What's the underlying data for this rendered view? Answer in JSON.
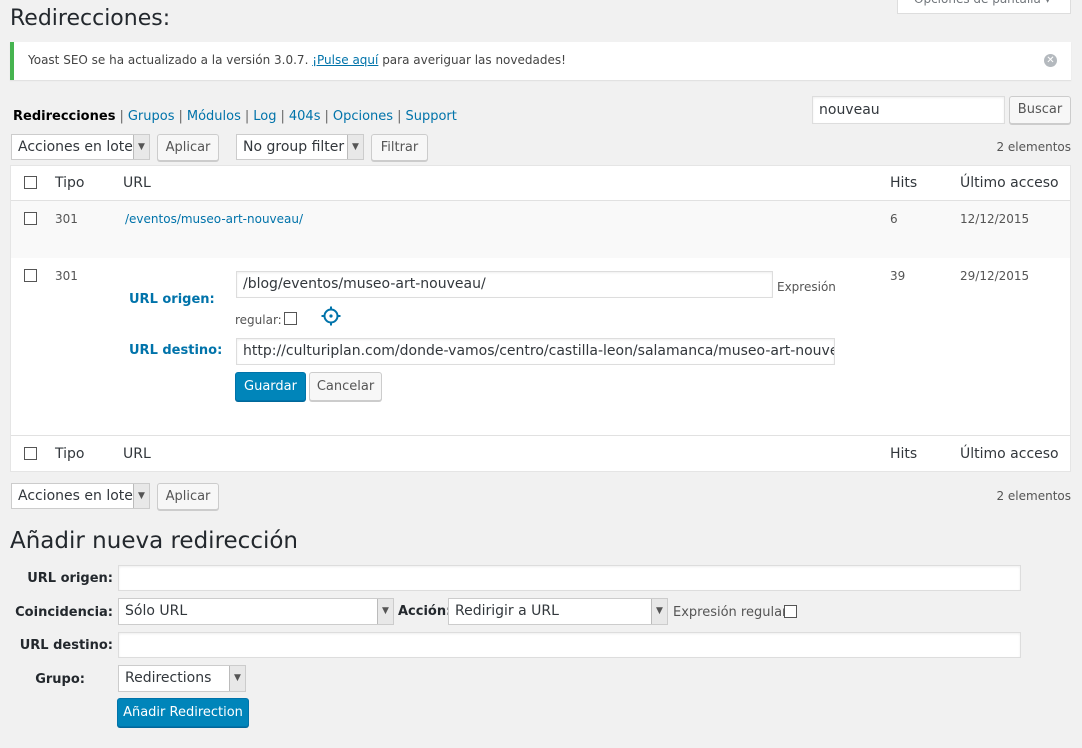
{
  "page": {
    "title": "Redirecciones:",
    "screen_options": "Opciones de pantalla ▾"
  },
  "notice": {
    "text_before": "Yoast SEO se ha actualizado a la versión 3.0.7.",
    "link": "¡Pulse aquí",
    "text_after": "para averiguar las novedades!"
  },
  "nav": {
    "items": [
      "Redirecciones",
      "Grupos",
      "Módulos",
      "Log",
      "404s",
      "Opciones",
      "Support"
    ],
    "separator": "|"
  },
  "search": {
    "value": "nouveau",
    "button": "Buscar"
  },
  "toolbar_top": {
    "bulk_actions": "Acciones en lote",
    "apply": "Aplicar",
    "group_filter": "No group filter",
    "filter": "Filtrar",
    "count": "2 elementos"
  },
  "table": {
    "columns": {
      "type": "Tipo",
      "url": "URL",
      "hits": "Hits",
      "last_access": "Último acceso"
    },
    "rows": [
      {
        "type": "301",
        "url": "/eventos/museo-art-nouveau/",
        "hits": "6",
        "last_access": "12/12/2015"
      },
      {
        "type": "301",
        "hits": "39",
        "last_access": "29/12/2015"
      }
    ],
    "edit": {
      "source_label": "URL origen:",
      "source_value": "/blog/eventos/museo-art-nouveau/",
      "regex_label_1": "Expresión",
      "regex_label_2": "regular:",
      "target_label": "URL destino:",
      "target_value": "http://culturiplan.com/donde-vamos/centro/castilla-leon/salamanca/museo-art-nouveau",
      "save": "Guardar",
      "cancel": "Cancelar"
    }
  },
  "toolbar_bottom": {
    "bulk_actions": "Acciones en lote",
    "apply": "Aplicar",
    "count": "2 elementos"
  },
  "add_new": {
    "title": "Añadir nueva redirección",
    "source_label": "URL origen:",
    "source_value": "",
    "match_label": "Coincidencia:",
    "match_value": "Sólo URL",
    "action_label": "Acción:",
    "action_value": "Redirigir a URL",
    "regex_label": "Expresión regular:",
    "target_label": "URL destino:",
    "target_value": "",
    "group_label": "Grupo:",
    "group_value": "Redirections",
    "submit": "Añadir Redirection"
  },
  "icons": {
    "dismiss": "dismiss-circle-icon",
    "regex_help": "gear-icon",
    "select_arrow": "chevron-down-icon"
  }
}
